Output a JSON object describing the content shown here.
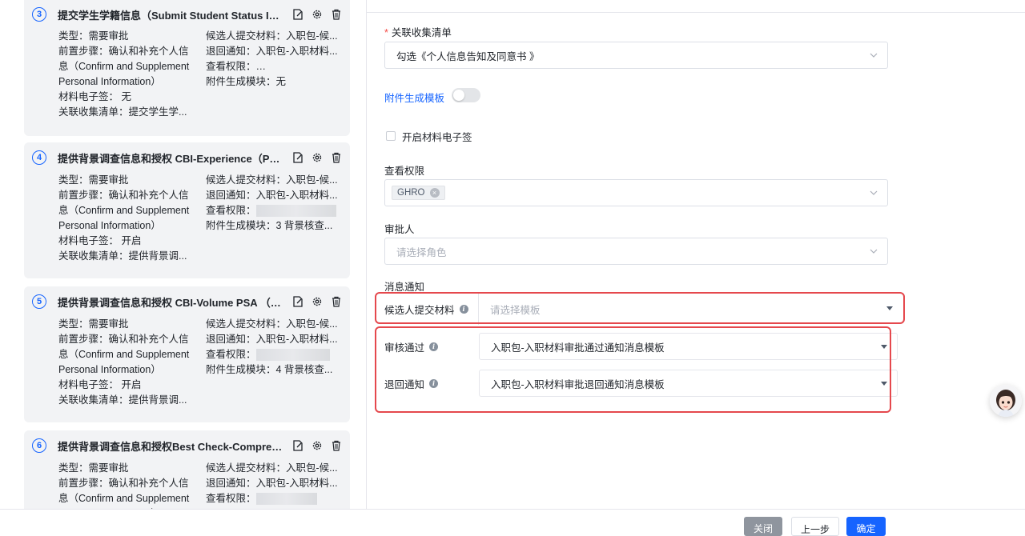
{
  "steps": [
    {
      "num": "3",
      "title": "提交学生学籍信息（Submit Student Status Infor...",
      "type_line": "类型：需要审批",
      "prereq_line": "前置步骤：确认和补充个人信息（Confirm and Supplement Personal Information）",
      "esign_line": "材料电子签：  无",
      "linked_line": "关联收集清单：提交学生学...",
      "submit_line": "候选人提交材料：入职包-候...",
      "return_line": "退回通知：入职包-入职材料...",
      "view_label": "查看权限：",
      "attach_line": "附件生成模块：无"
    },
    {
      "num": "4",
      "title": "提供背景调查信息和授权 CBI-Experience（Prov...",
      "type_line": "类型：需要审批",
      "prereq_line": "前置步骤：确认和补充个人信息（Confirm and Supplement Personal Information）",
      "esign_line": "材料电子签：  开启",
      "linked_line": "关联收集清单：提供背景调...",
      "submit_line": "候选人提交材料：入职包-候...",
      "return_line": "退回通知：入职包-入职材料...",
      "view_label": "查看权限：",
      "attach_line": "附件生成模块：3 背景核查..."
    },
    {
      "num": "5",
      "title": "提供背景调查信息和授权 CBI-Volume PSA （Pr...",
      "type_line": "类型：需要审批",
      "prereq_line": "前置步骤：确认和补充个人信息（Confirm and Supplement Personal Information）",
      "esign_line": "材料电子签：  开启",
      "linked_line": "关联收集清单：提供背景调...",
      "submit_line": "候选人提交材料：入职包-候...",
      "return_line": "退回通知：入职包-入职材料...",
      "view_label": "查看权限：",
      "attach_line": "附件生成模块：4 背景核查..."
    },
    {
      "num": "6",
      "title": "提供背景调查信息和授权Best Check-Comprehe...",
      "type_line": "类型：需要审批",
      "prereq_line": "前置步骤：确认和补充个人信息（Confirm and Supplement Personal Information）",
      "esign_line": "",
      "linked_line": "",
      "submit_line": "候选人提交材料：入职包-候...",
      "return_line": "退回通知：入职包-入职材料...",
      "view_label": "查看权限：",
      "attach_line": ""
    }
  ],
  "form": {
    "linked_list_label": "关联收集清单",
    "linked_list_value": "勾选《个人信息告知及同意书 》",
    "attach_template_label": "附件生成模板",
    "esign_checkbox_label": "开启材料电子签",
    "view_perm_label": "查看权限",
    "view_perm_tag": "GHRO",
    "approver_label": "审批人",
    "approver_placeholder": "请选择角色",
    "notify_label": "消息通知",
    "candidate_submit_label": "候选人提交材料",
    "candidate_submit_placeholder": "请选择模板",
    "approve_label": "审核通过",
    "approve_value": "入职包-入职材料审批通过通知消息模板",
    "return_label": "退回通知",
    "return_value": "入职包-入职材料审批退回通知消息模板"
  },
  "footer": {
    "close": "关闭",
    "prev": "上一步",
    "confirm": "确定"
  },
  "colors": {
    "accent": "#1664ff",
    "highlight_border": "#e5484d",
    "required": "#f54a45"
  }
}
